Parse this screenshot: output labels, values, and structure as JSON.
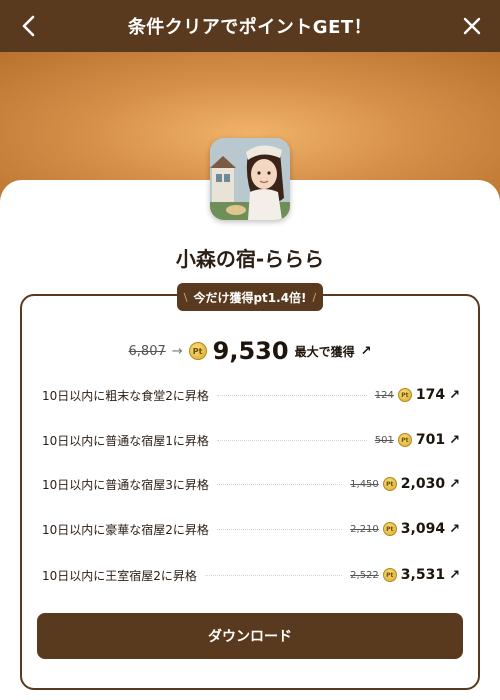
{
  "header": {
    "title": "条件クリアでポイントGET！",
    "back_icon": "chevron-left-icon",
    "close_icon": "close-icon"
  },
  "colors": {
    "header_bg": "#5a3a1f",
    "accent": "#5a3a1f",
    "hero_gradient": [
      "#f0b36a",
      "#b8722e"
    ],
    "coin": "#e8c24a"
  },
  "app": {
    "name": "小森の宿-ららら",
    "icon": "app-icon-girl-character"
  },
  "badge": {
    "left": "\\",
    "text": "今だけ獲得pt1.4倍!",
    "right": "/"
  },
  "total": {
    "old": "6,807",
    "arrow": "→",
    "coin": "Pt",
    "new": "9,530",
    "suffix": "最大で獲得",
    "ext": "↗"
  },
  "tasks": [
    {
      "label": "10日以内に粗末な食堂2に昇格",
      "old": "124",
      "new": "174"
    },
    {
      "label": "10日以内に普通な宿屋1に昇格",
      "old": "501",
      "new": "701"
    },
    {
      "label": "10日以内に普通な宿屋3に昇格",
      "old": "1,450",
      "new": "2,030"
    },
    {
      "label": "10日以内に豪華な宿屋2に昇格",
      "old": "2,210",
      "new": "3,094"
    },
    {
      "label": "10日以内に王室宿屋2に昇格",
      "old": "2,522",
      "new": "3,531"
    }
  ],
  "task_coin": "Pt",
  "task_ext": "↗",
  "download_button": "ダウンロード"
}
